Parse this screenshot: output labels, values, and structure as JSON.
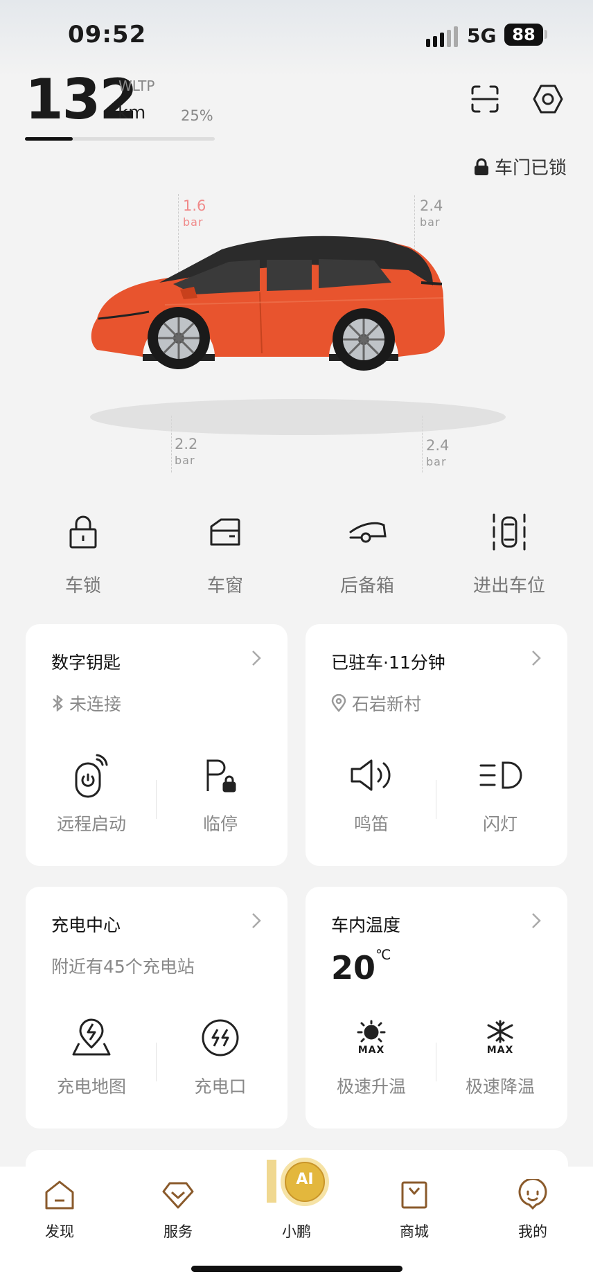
{
  "status_bar": {
    "time": "09:52",
    "network": "5G",
    "battery": "88"
  },
  "range": {
    "value": "132",
    "standard": "WLTP",
    "unit": "km",
    "percent": "25%",
    "battery_fraction": 0.25
  },
  "header": {
    "scan_icon": "scan-icon",
    "settings_icon": "settings-icon",
    "lock_status": "车门已锁"
  },
  "tires": {
    "front_left": {
      "value": "1.6",
      "unit": "bar",
      "color": "#f08a8a"
    },
    "rear_left": {
      "value": "2.4",
      "unit": "bar",
      "color": "#999999"
    },
    "front_right": {
      "value": "2.2",
      "unit": "bar",
      "color": "#999999"
    },
    "rear_right": {
      "value": "2.4",
      "unit": "bar",
      "color": "#999999"
    }
  },
  "car": {
    "body_color": "#e8542e",
    "roof_color": "#2b2b2b"
  },
  "quick_actions": [
    {
      "label": "车锁",
      "icon": "lock-icon"
    },
    {
      "label": "车窗",
      "icon": "window-icon"
    },
    {
      "label": "后备箱",
      "icon": "trunk-icon"
    },
    {
      "label": "进出车位",
      "icon": "parking-exit-icon"
    }
  ],
  "cards": {
    "digital_key": {
      "title": "数字钥匙",
      "status": "未连接",
      "actions": [
        {
          "label": "远程启动",
          "icon": "remote-start-icon"
        },
        {
          "label": "临停",
          "icon": "temporary-parking-icon"
        }
      ]
    },
    "parking": {
      "title": "已驻车·11分钟",
      "location": "石岩新村",
      "actions": [
        {
          "label": "鸣笛",
          "icon": "horn-icon"
        },
        {
          "label": "闪灯",
          "icon": "flash-lights-icon"
        }
      ]
    },
    "charging": {
      "title": "充电中心",
      "subtitle": "附近有45个充电站",
      "actions": [
        {
          "label": "充电地图",
          "icon": "charging-map-icon"
        },
        {
          "label": "充电口",
          "icon": "charge-port-icon"
        }
      ]
    },
    "cabin_temp": {
      "title": "车内温度",
      "value": "20",
      "unit": "℃",
      "actions": [
        {
          "label": "极速升温",
          "icon": "max-heat-icon",
          "badge": "MAX"
        },
        {
          "label": "极速降温",
          "icon": "max-cool-icon",
          "badge": "MAX"
        }
      ]
    }
  },
  "tab_bar": {
    "items": [
      {
        "label": "发现",
        "icon": "home-icon"
      },
      {
        "label": "服务",
        "icon": "service-icon"
      },
      {
        "label": "小鹏",
        "icon": "ai-assistant-icon",
        "badge_text": "AI"
      },
      {
        "label": "商城",
        "icon": "shop-icon"
      },
      {
        "label": "我的",
        "icon": "profile-icon"
      }
    ],
    "accent": "#8a5a2b"
  }
}
